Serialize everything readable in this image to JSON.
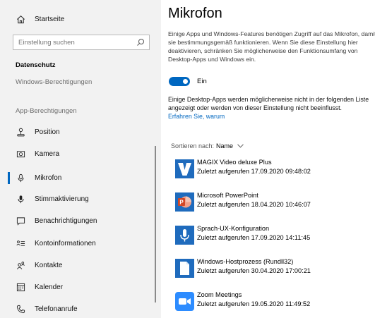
{
  "sidebar": {
    "home_label": "Startseite",
    "search_placeholder": "Einstellung suchen",
    "section_title": "Datenschutz",
    "windows_permissions": "Windows-Berechtigungen",
    "app_permissions": "App-Berechtigungen",
    "items": [
      {
        "label": "Position",
        "icon": "location-icon"
      },
      {
        "label": "Kamera",
        "icon": "camera-icon"
      },
      {
        "label": "Mikrofon",
        "icon": "microphone-icon",
        "selected": true
      },
      {
        "label": "Stimmaktivierung",
        "icon": "voice-activation-icon"
      },
      {
        "label": "Benachrichtigungen",
        "icon": "notifications-icon"
      },
      {
        "label": "Kontoinformationen",
        "icon": "account-info-icon"
      },
      {
        "label": "Kontakte",
        "icon": "contacts-icon"
      },
      {
        "label": "Kalender",
        "icon": "calendar-icon"
      },
      {
        "label": "Telefonanrufe",
        "icon": "phone-icon"
      }
    ]
  },
  "main": {
    "title": "Mikrofon",
    "description": "Einige Apps und Windows-Features benötigen Zugriff auf das Mikrofon, damit sie bestimmungsgemäß funktionieren. Wenn Sie diese Einstellung hier deaktivieren, schränken Sie möglicherweise den Funktionsumfang von Desktop-Apps und Windows ein.",
    "toggle_label": "Ein",
    "toggle_on": true,
    "info": "Einige Desktop-Apps werden möglicherweise nicht in der folgenden Liste angezeigt oder werden von dieser Einstellung nicht beeinflusst.",
    "link": "Erfahren Sie, warum",
    "sort_label": "Sortieren nach:",
    "sort_value": "Name",
    "apps": [
      {
        "name": "MAGIX Video deluxe Plus",
        "last": "Zuletzt aufgerufen 17.09.2020 09:48:02",
        "icon": "magix-icon"
      },
      {
        "name": "Microsoft PowerPoint",
        "last": "Zuletzt aufgerufen 18.04.2020 10:46:07",
        "icon": "powerpoint-icon"
      },
      {
        "name": "Sprach-UX-Konfiguration",
        "last": "Zuletzt aufgerufen 17.09.2020 14:11:45",
        "icon": "speech-ux-icon"
      },
      {
        "name": "Windows-Hostprozess (Rundll32)",
        "last": "Zuletzt aufgerufen 30.04.2020 17:00:21",
        "icon": "file-icon"
      },
      {
        "name": "Zoom Meetings",
        "last": "Zuletzt aufgerufen 19.05.2020 11:49:52",
        "icon": "zoom-icon"
      }
    ]
  },
  "colors": {
    "accent": "#0067c0",
    "sidebar_bg": "#f2f2f2",
    "zoom": "#2d8cff",
    "powerpoint": "#d24726"
  }
}
